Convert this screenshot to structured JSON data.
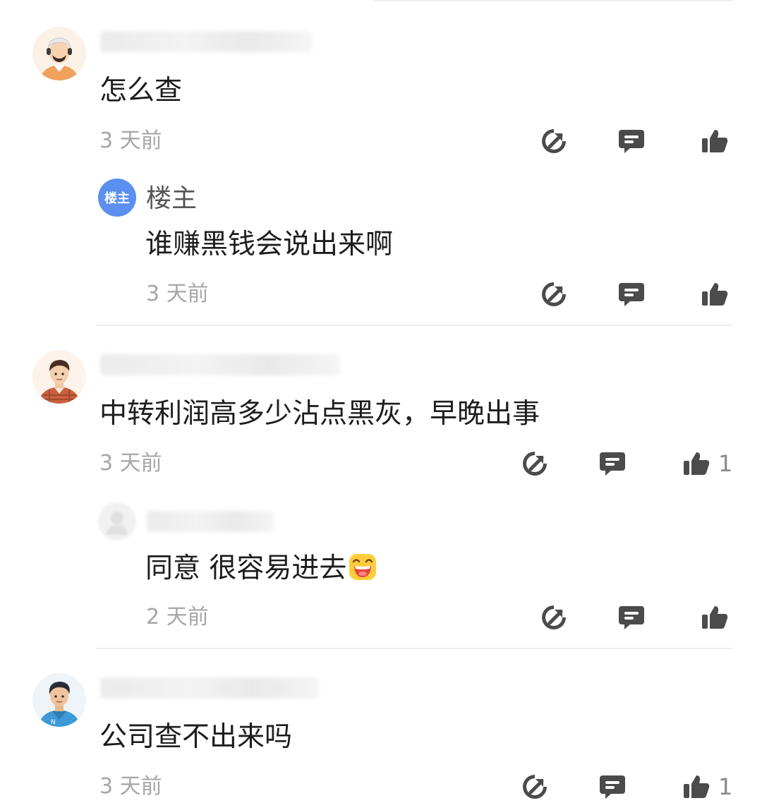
{
  "comments": [
    {
      "text": "怎么查",
      "time": "3 天前",
      "likes": "",
      "reply": {
        "author": "楼主",
        "badge": "楼主",
        "text": "谁赚黑钱会说出来啊",
        "time": "3 天前"
      }
    },
    {
      "text": "中转利润高多少沾点黑灰，早晚出事",
      "time": "3 天前",
      "likes": "1",
      "reply": {
        "text": "同意 很容易进去",
        "emoji": "grinning-emoji",
        "time": "2 天前"
      }
    },
    {
      "text": "公司查不出来吗",
      "time": "3 天前",
      "likes": "1"
    }
  ],
  "icons": {
    "share": "share-arrow-icon",
    "reply": "comment-bubble-icon",
    "like": "thumbs-up-icon"
  },
  "colors": {
    "badge_blue": "#5b8ff0",
    "icon_gray": "#4b4b4b",
    "time_gray": "#a6a6a6",
    "avatar_orange": "#f0a15c"
  }
}
